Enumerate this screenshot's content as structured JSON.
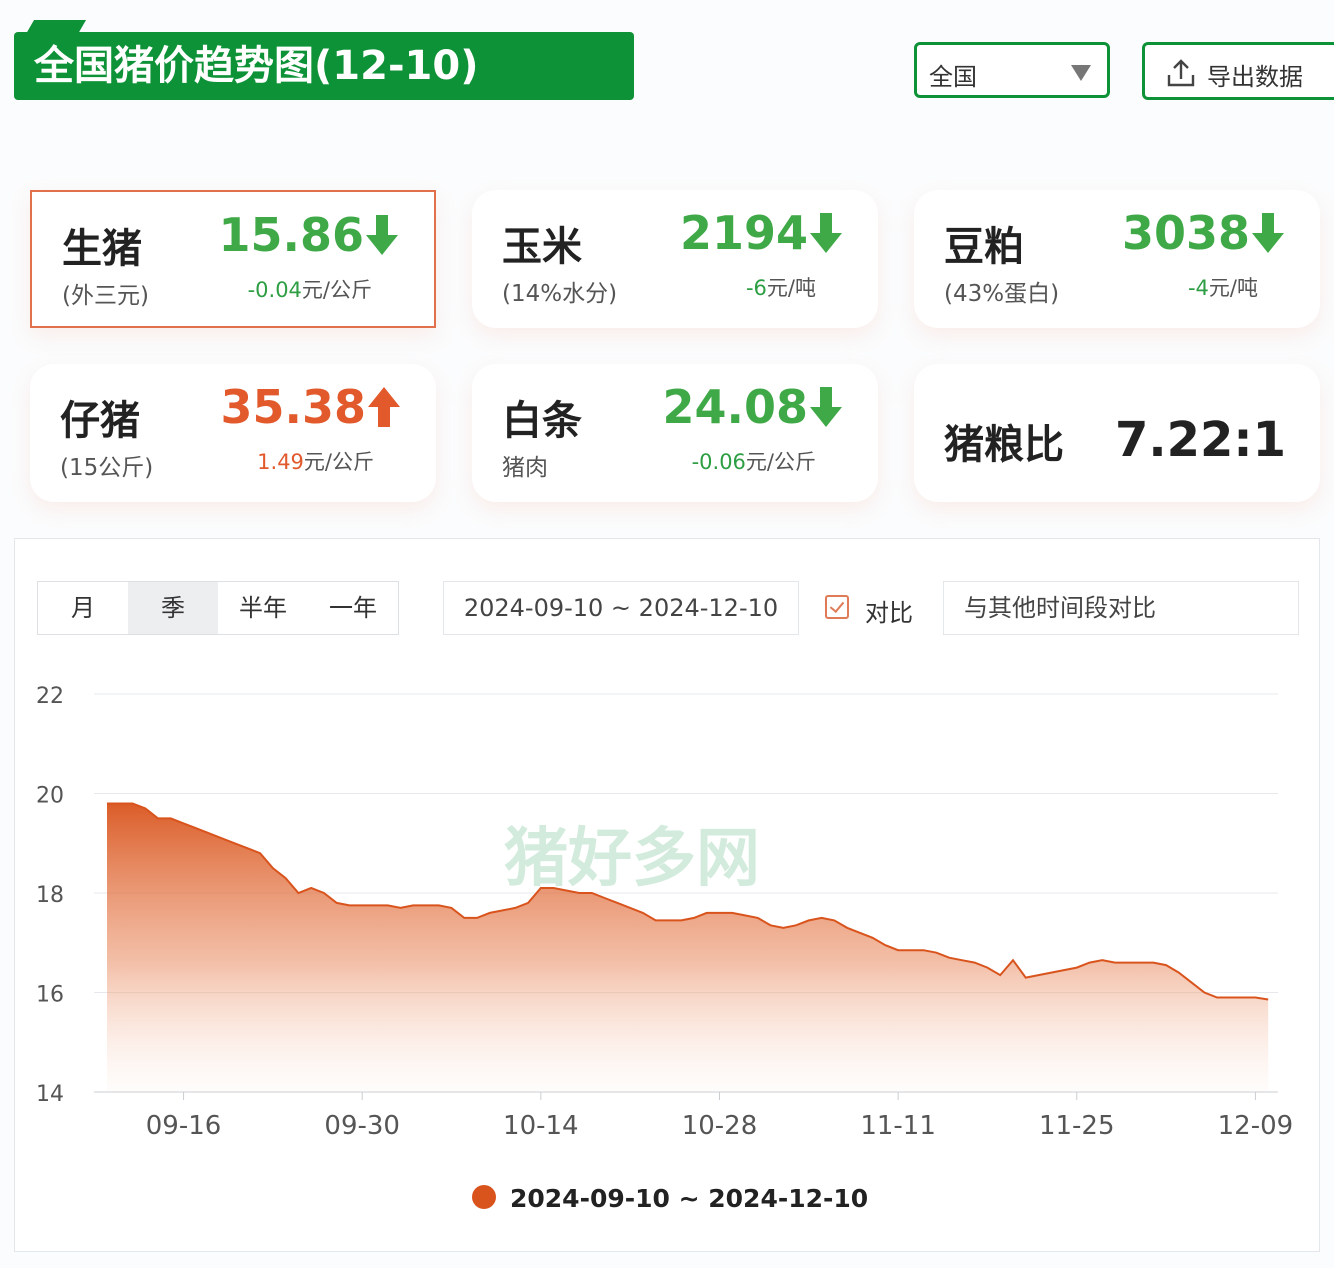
{
  "title": "全国猪价趋势图(12-10)",
  "region_select": {
    "value": "全国"
  },
  "export_button": {
    "label": "导出数据"
  },
  "cards": [
    {
      "name": "生猪",
      "sub": "(外三元)",
      "price": "15.86",
      "direction": "down",
      "change": "-0.04",
      "unit": "元/公斤",
      "active": true
    },
    {
      "name": "玉米",
      "sub": "(14%水分)",
      "price": "2194",
      "direction": "down",
      "change": "-6",
      "unit": "元/吨",
      "active": false
    },
    {
      "name": "豆粕",
      "sub": "(43%蛋白)",
      "price": "3038",
      "direction": "down",
      "change": "-4",
      "unit": "元/吨",
      "active": false
    },
    {
      "name": "仔猪",
      "sub": "(15公斤)",
      "price": "35.38",
      "direction": "up",
      "change": "1.49",
      "unit": "元/公斤",
      "active": false
    },
    {
      "name": "白条",
      "sub": "猪肉",
      "price": "24.08",
      "direction": "down",
      "change": "-0.06",
      "unit": "元/公斤",
      "active": false
    }
  ],
  "ratio_card": {
    "name": "猪粮比",
    "value": "7.22:1"
  },
  "tabs": [
    {
      "label": "月",
      "selected": false
    },
    {
      "label": "季",
      "selected": true
    },
    {
      "label": "半年",
      "selected": false
    },
    {
      "label": "一年",
      "selected": false
    }
  ],
  "date_range": "2024-09-10 ~ 2024-12-10",
  "compare": {
    "label": "对比",
    "checked": true
  },
  "compare_input": {
    "placeholder": "与其他时间段对比"
  },
  "watermark": "猪好多网",
  "colors": {
    "brand_green": "#0e9237",
    "down_green": "#3fa847",
    "up_orange": "#e2592c",
    "series": "#d9541d"
  },
  "chart_data": {
    "type": "area",
    "ylim": [
      14,
      22
    ],
    "yticks": [
      14,
      16,
      18,
      20,
      22
    ],
    "x_tick_labels": [
      "09-16",
      "09-30",
      "10-14",
      "10-28",
      "11-11",
      "11-25",
      "12-09"
    ],
    "grid": true,
    "legend_position": "bottom",
    "series": [
      {
        "name": "2024-09-10 ~ 2024-12-10",
        "color": "#d9541d",
        "points": [
          [
            "09-10",
            19.8
          ],
          [
            "09-11",
            19.8
          ],
          [
            "09-12",
            19.8
          ],
          [
            "09-13",
            19.7
          ],
          [
            "09-14",
            19.5
          ],
          [
            "09-15",
            19.5
          ],
          [
            "09-16",
            19.4
          ],
          [
            "09-17",
            19.3
          ],
          [
            "09-18",
            19.2
          ],
          [
            "09-19",
            19.1
          ],
          [
            "09-20",
            19.0
          ],
          [
            "09-21",
            18.9
          ],
          [
            "09-22",
            18.8
          ],
          [
            "09-23",
            18.5
          ],
          [
            "09-24",
            18.3
          ],
          [
            "09-25",
            18.0
          ],
          [
            "09-26",
            18.1
          ],
          [
            "09-27",
            18.0
          ],
          [
            "09-28",
            17.8
          ],
          [
            "09-29",
            17.75
          ],
          [
            "09-30",
            17.75
          ],
          [
            "10-01",
            17.75
          ],
          [
            "10-02",
            17.75
          ],
          [
            "10-03",
            17.7
          ],
          [
            "10-04",
            17.75
          ],
          [
            "10-05",
            17.75
          ],
          [
            "10-06",
            17.75
          ],
          [
            "10-07",
            17.7
          ],
          [
            "10-08",
            17.5
          ],
          [
            "10-09",
            17.5
          ],
          [
            "10-10",
            17.6
          ],
          [
            "10-11",
            17.65
          ],
          [
            "10-12",
            17.7
          ],
          [
            "10-13",
            17.8
          ],
          [
            "10-14",
            18.1
          ],
          [
            "10-15",
            18.1
          ],
          [
            "10-16",
            18.05
          ],
          [
            "10-17",
            18.0
          ],
          [
            "10-18",
            18.0
          ],
          [
            "10-19",
            17.9
          ],
          [
            "10-20",
            17.8
          ],
          [
            "10-21",
            17.7
          ],
          [
            "10-22",
            17.6
          ],
          [
            "10-23",
            17.45
          ],
          [
            "10-24",
            17.45
          ],
          [
            "10-25",
            17.45
          ],
          [
            "10-26",
            17.5
          ],
          [
            "10-27",
            17.6
          ],
          [
            "10-28",
            17.6
          ],
          [
            "10-29",
            17.6
          ],
          [
            "10-30",
            17.55
          ],
          [
            "10-31",
            17.5
          ],
          [
            "11-01",
            17.35
          ],
          [
            "11-02",
            17.3
          ],
          [
            "11-03",
            17.35
          ],
          [
            "11-04",
            17.45
          ],
          [
            "11-05",
            17.5
          ],
          [
            "11-06",
            17.45
          ],
          [
            "11-07",
            17.3
          ],
          [
            "11-08",
            17.2
          ],
          [
            "11-09",
            17.1
          ],
          [
            "11-10",
            16.95
          ],
          [
            "11-11",
            16.85
          ],
          [
            "11-12",
            16.85
          ],
          [
            "11-13",
            16.85
          ],
          [
            "11-14",
            16.8
          ],
          [
            "11-15",
            16.7
          ],
          [
            "11-16",
            16.65
          ],
          [
            "11-17",
            16.6
          ],
          [
            "11-18",
            16.5
          ],
          [
            "11-19",
            16.35
          ],
          [
            "11-20",
            16.65
          ],
          [
            "11-21",
            16.3
          ],
          [
            "11-22",
            16.35
          ],
          [
            "11-23",
            16.4
          ],
          [
            "11-24",
            16.45
          ],
          [
            "11-25",
            16.5
          ],
          [
            "11-26",
            16.6
          ],
          [
            "11-27",
            16.65
          ],
          [
            "11-28",
            16.6
          ],
          [
            "11-29",
            16.6
          ],
          [
            "11-30",
            16.6
          ],
          [
            "12-01",
            16.6
          ],
          [
            "12-02",
            16.55
          ],
          [
            "12-03",
            16.4
          ],
          [
            "12-04",
            16.2
          ],
          [
            "12-05",
            16.0
          ],
          [
            "12-06",
            15.9
          ],
          [
            "12-07",
            15.9
          ],
          [
            "12-08",
            15.9
          ],
          [
            "12-09",
            15.9
          ],
          [
            "12-10",
            15.86
          ]
        ]
      }
    ]
  }
}
